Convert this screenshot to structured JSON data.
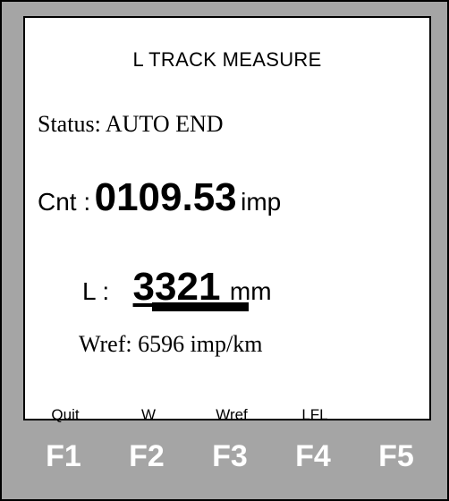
{
  "screen": {
    "title": "L TRACK MEASURE",
    "status": "Status: AUTO END",
    "counter": {
      "label": "Cnt :",
      "value": "0109.53",
      "unit": "imp"
    },
    "length": {
      "label": "L :",
      "value": "3321",
      "unit": "mm",
      "progress_fraction": 1.0
    },
    "wref": "Wref:  6596 imp/km"
  },
  "softkeys": [
    "Quit",
    "W",
    "Wref",
    "LFL",
    ""
  ],
  "function_keys": [
    "F1",
    "F2",
    "F3",
    "F4",
    "F5"
  ],
  "colors": {
    "bezel": "#a5a5a5",
    "screen": "#ffffff",
    "key_text": "#ffffff"
  }
}
